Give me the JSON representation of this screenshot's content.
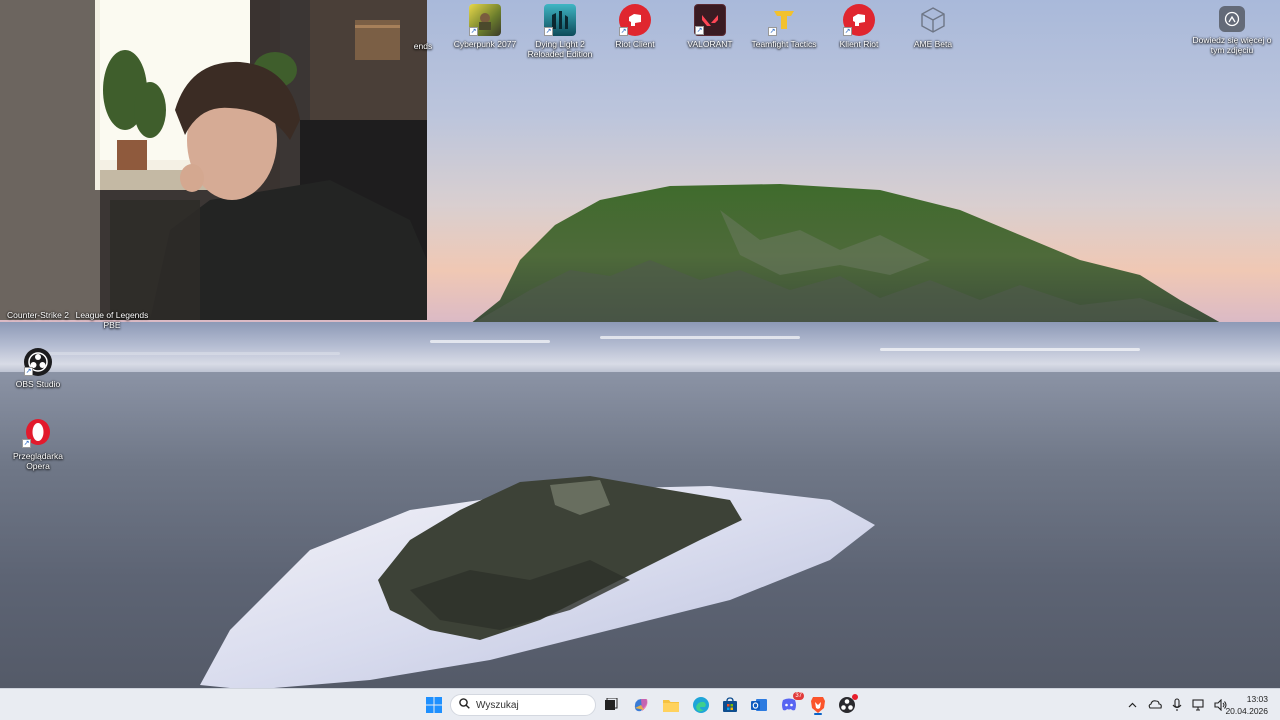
{
  "desktop_icons": [
    {
      "name": "league-of-legends-partial-icon",
      "label": "ends"
    },
    {
      "name": "cyberpunk-icon",
      "label": "Cyberpunk 2077"
    },
    {
      "name": "dying-light-icon",
      "label": "Dying Light 2 Reloaded Edition"
    },
    {
      "name": "riot-client-icon",
      "label": "Riot Client"
    },
    {
      "name": "valorant-icon",
      "label": "VALORANT"
    },
    {
      "name": "teamfight-tactics-icon",
      "label": "Teamfight Tactics"
    },
    {
      "name": "klient-riot-icon",
      "label": "Klient Riot"
    },
    {
      "name": "ame-beta-icon",
      "label": "AME Beta"
    }
  ],
  "left_icons": [
    {
      "name": "counter-strike-icon",
      "label": "Counter-Strike 2"
    },
    {
      "name": "league-pbe-icon",
      "label": "League of Legends PBE"
    },
    {
      "name": "obs-icon",
      "label": "OBS Studio"
    },
    {
      "name": "opera-icon",
      "label": "Przeglądarka Opera"
    }
  ],
  "spotlight": {
    "label": "Dowiedz się więcej o tym zdjęciu"
  },
  "taskbar": {
    "search_placeholder": "Wyszukaj",
    "pinned": [
      "start-icon",
      "search-icon",
      "task-view-icon",
      "copilot-icon",
      "file-explorer-icon",
      "edge-icon",
      "store-icon",
      "outlook-icon",
      "discord-icon",
      "brave-icon",
      "obs-taskbar-icon"
    ],
    "discord_badge": "37"
  },
  "tray": {
    "time": "13:03",
    "date": "20.04.2026"
  },
  "colors": {
    "taskbar_bg": "#e9ecf2",
    "accent": "#0a64c8",
    "riot_red": "#e0262f",
    "valorant_red": "#ff4655"
  }
}
